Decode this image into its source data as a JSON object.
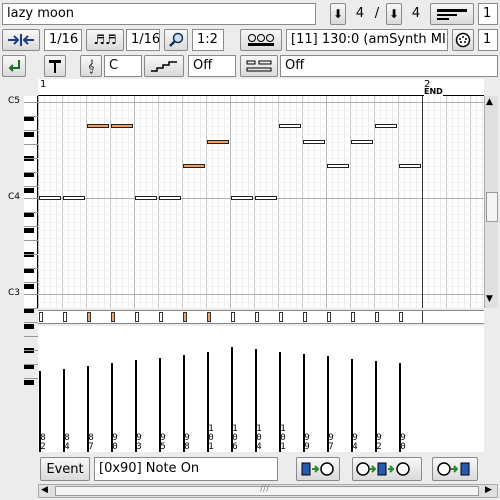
{
  "song_name": "lazy moon",
  "time_sig": {
    "num": "4",
    "den": "4"
  },
  "instance_number": "1",
  "snap": "1/16",
  "length": "1/16",
  "zoom": "1:2",
  "track": "[11] 130:0 (amSynth MIDI I",
  "channel": "1",
  "key": "C",
  "scale": "Off",
  "chord": "Off",
  "ruler": {
    "bar1": "1",
    "bar2": "2",
    "end": "END"
  },
  "note_labels": {
    "c5": "C5",
    "c4": "C4",
    "c3": "C3"
  },
  "velocities": [
    {
      "label": [
        "8",
        "2"
      ],
      "value": 82
    },
    {
      "label": [
        "8",
        "4"
      ],
      "value": 84
    },
    {
      "label": [
        "8",
        "7"
      ],
      "value": 87
    },
    {
      "label": [
        "9",
        "0"
      ],
      "value": 90
    },
    {
      "label": [
        "9",
        "3"
      ],
      "value": 93
    },
    {
      "label": [
        "9",
        "5"
      ],
      "value": 95
    },
    {
      "label": [
        "9",
        "8"
      ],
      "value": 98
    },
    {
      "label": [
        "1",
        "0",
        "1"
      ],
      "value": 101
    },
    {
      "label": [
        "1",
        "0",
        "6"
      ],
      "value": 106
    },
    {
      "label": [
        "1",
        "0",
        "4"
      ],
      "value": 104
    },
    {
      "label": [
        "1",
        "0",
        "1"
      ],
      "value": 101
    },
    {
      "label": [
        "9",
        "9"
      ],
      "value": 99
    },
    {
      "label": [
        "9",
        "7"
      ],
      "value": 97
    },
    {
      "label": [
        "9",
        "4"
      ],
      "value": 94
    },
    {
      "label": [
        "9",
        "2"
      ],
      "value": 92
    },
    {
      "label": [
        "9",
        "0"
      ],
      "value": 90
    }
  ],
  "notes": [
    {
      "step": 0,
      "pitch": "C4",
      "selected": false
    },
    {
      "step": 1,
      "pitch": "C4",
      "selected": false
    },
    {
      "step": 2,
      "pitch": "A4",
      "selected": true
    },
    {
      "step": 3,
      "pitch": "A4",
      "selected": true
    },
    {
      "step": 4,
      "pitch": "C4",
      "selected": false
    },
    {
      "step": 5,
      "pitch": "C4",
      "selected": false
    },
    {
      "step": 6,
      "pitch": "E4",
      "selected": true
    },
    {
      "step": 7,
      "pitch": "G4",
      "selected": true
    },
    {
      "step": 8,
      "pitch": "C4",
      "selected": false
    },
    {
      "step": 9,
      "pitch": "C4",
      "selected": false
    },
    {
      "step": 10,
      "pitch": "A4",
      "selected": false
    },
    {
      "step": 11,
      "pitch": "G4",
      "selected": false
    },
    {
      "step": 12,
      "pitch": "E4",
      "selected": false
    },
    {
      "step": 13,
      "pitch": "G4",
      "selected": false
    },
    {
      "step": 14,
      "pitch": "A4",
      "selected": false
    },
    {
      "step": 15,
      "pitch": "E4",
      "selected": false
    }
  ],
  "event_label": "Event",
  "event_value": "[0x90] Note On",
  "colors": {
    "selected_note": "#f0a060",
    "grid_light": "#d8d8d8",
    "grid_beat": "#b8b8b8"
  }
}
